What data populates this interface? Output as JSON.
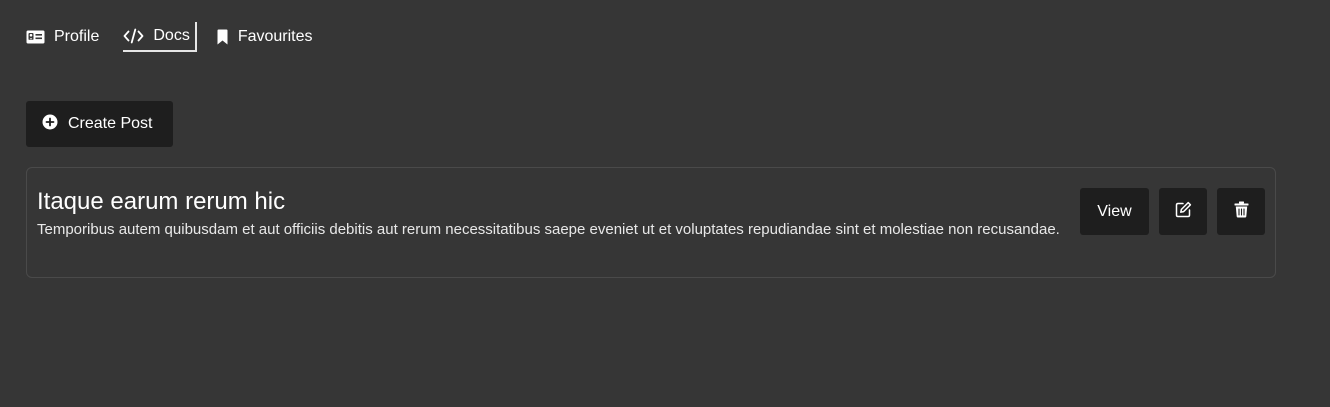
{
  "nav": {
    "tabs": [
      {
        "label": "Profile",
        "icon": "id-card-icon"
      },
      {
        "label": "Docs",
        "icon": "code-icon",
        "active": true
      },
      {
        "label": "Favourites",
        "icon": "bookmark-icon"
      }
    ]
  },
  "toolbar": {
    "create_label": "Create Post",
    "create_icon": "plus-circle-icon"
  },
  "posts": [
    {
      "title": "Itaque earum rerum hic",
      "body": "Temporibus autem quibusdam et aut officiis debitis aut rerum necessitatibus saepe eveniet ut et voluptates repudiandae sint et molestiae non recusandae.",
      "view_label": "View",
      "edit_icon": "edit-icon",
      "delete_icon": "trash-icon"
    }
  ],
  "colors": {
    "background": "#363636",
    "button": "#1e1e1e",
    "card_border": "#4a4a4a",
    "text": "#ffffff"
  }
}
